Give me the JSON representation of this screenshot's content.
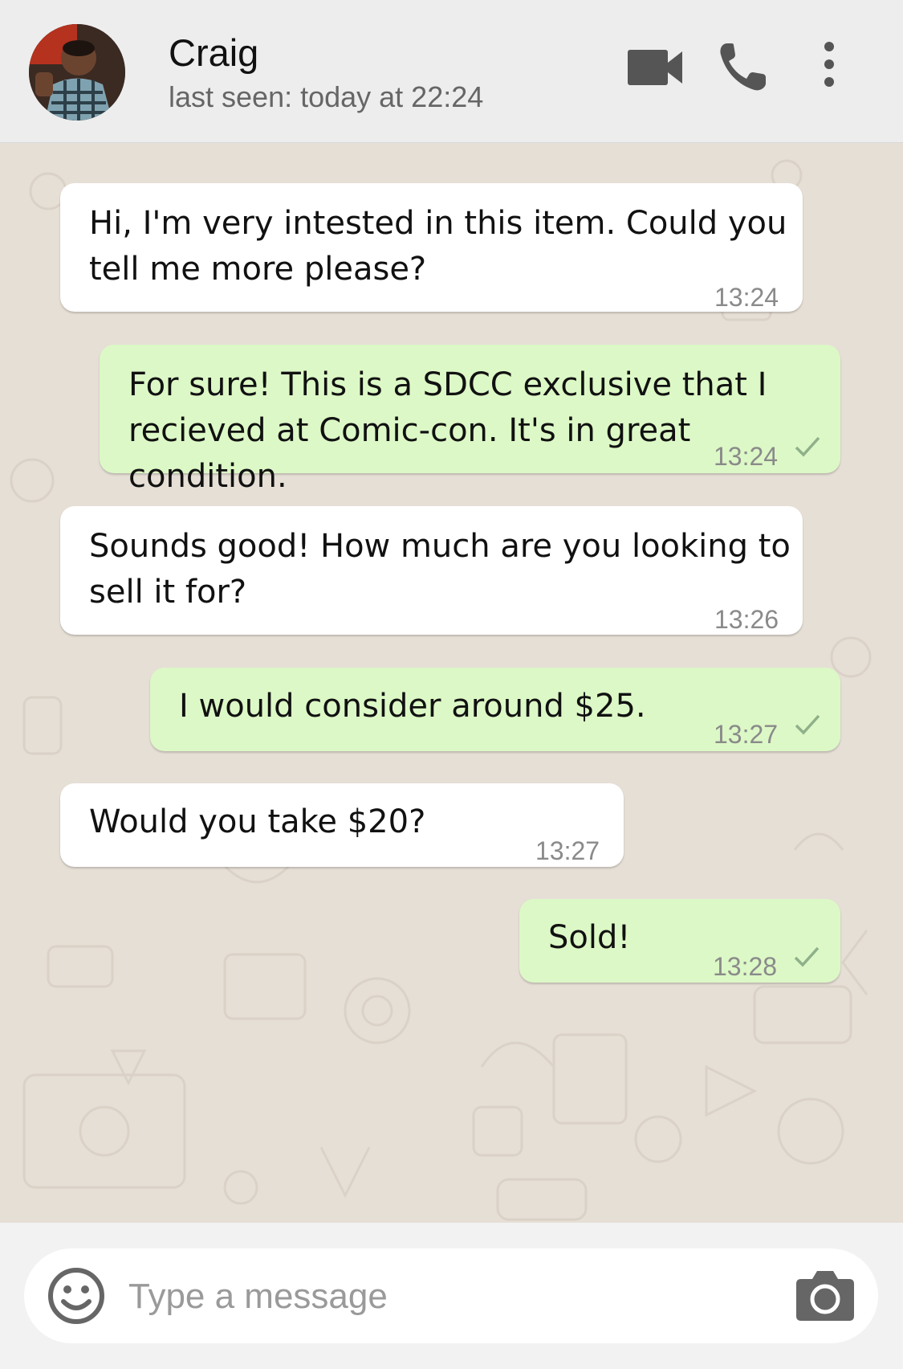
{
  "header": {
    "contact_name": "Craig",
    "last_seen": "last seen: today at 22:24",
    "icons": [
      "avatar",
      "video-call-icon",
      "voice-call-icon",
      "more-menu-icon"
    ]
  },
  "messages": [
    {
      "direction": "incoming",
      "text": "Hi, I'm very intested in this item. Could you\ntell me more please?",
      "time": "13:24"
    },
    {
      "direction": "outgoing",
      "text": "For sure! This is a SDCC exclusive that I\nrecieved at Comic-con. It's in great condition.",
      "time": "13:24",
      "status": "sent"
    },
    {
      "direction": "incoming",
      "text": "Sounds good! How much are you looking to\nsell it for?",
      "time": "13:26"
    },
    {
      "direction": "outgoing",
      "text": "I would consider around $25.",
      "time": "13:27",
      "status": "sent"
    },
    {
      "direction": "incoming",
      "text": "Would you take $20?",
      "time": "13:27"
    },
    {
      "direction": "outgoing",
      "text": "Sold!",
      "time": "13:28",
      "status": "sent"
    }
  ],
  "composer": {
    "placeholder": "Type a message",
    "value": "",
    "icons": [
      "emoji-icon",
      "camera-icon"
    ]
  },
  "colors": {
    "header_bg": "#ededed",
    "chat_bg": "#e6dfd6",
    "incoming_bubble": "#ffffff",
    "outgoing_bubble": "#dcf8c6",
    "icon_gray": "#555555"
  }
}
